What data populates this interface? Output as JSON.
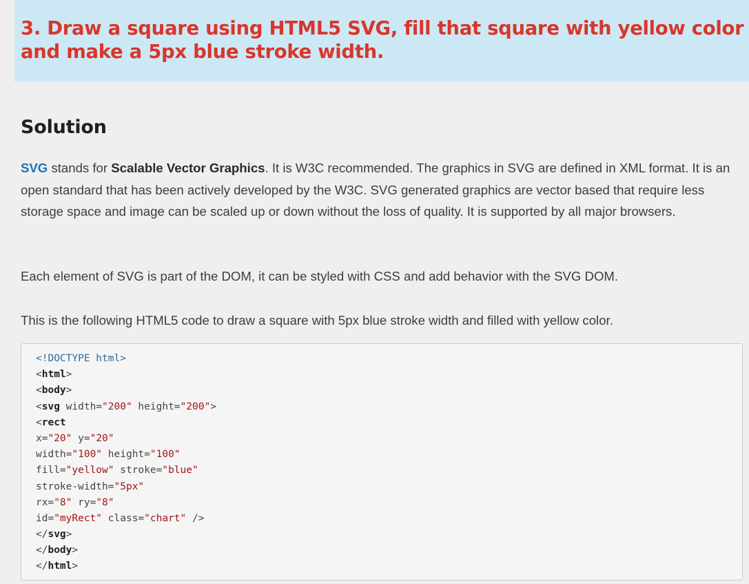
{
  "question": {
    "title": "3. Draw a square using HTML5 SVG, fill that square with yellow color and make a 5px blue stroke width."
  },
  "solution": {
    "heading": "Solution",
    "paragraph1": {
      "link": "SVG",
      "text_a": " stands for ",
      "bold": "Scalable Vector Graphics",
      "text_b": ". It is W3C recommended. The graphics in SVG are defined in XML format. It is an open standard that has been actively developed by the W3C. SVG generated graphics are vector based that require less storage space and image can be scaled up or down without the loss of quality. It is supported by all major browsers."
    },
    "paragraph2": "Each element of SVG is part of the DOM, it can be styled with CSS and add behavior with the SVG DOM.",
    "paragraph3": "This is the following HTML5 code to draw a square with 5px blue stroke width and filled with yellow color."
  },
  "code": {
    "lines": [
      [
        {
          "t": "doctype",
          "v": "<!DOCTYPE html>"
        }
      ],
      [
        {
          "t": "punct",
          "v": "<"
        },
        {
          "t": "tag",
          "v": "html"
        },
        {
          "t": "punct",
          "v": ">"
        }
      ],
      [
        {
          "t": "punct",
          "v": "<"
        },
        {
          "t": "tag",
          "v": "body"
        },
        {
          "t": "punct",
          "v": ">"
        }
      ],
      [
        {
          "t": "punct",
          "v": "<"
        },
        {
          "t": "tag",
          "v": "svg"
        },
        {
          "t": "attr",
          "v": " width="
        },
        {
          "t": "val",
          "v": "\"200\""
        },
        {
          "t": "attr",
          "v": " height="
        },
        {
          "t": "val",
          "v": "\"200\""
        },
        {
          "t": "punct",
          "v": ">"
        }
      ],
      [
        {
          "t": "punct",
          "v": "<"
        },
        {
          "t": "tag",
          "v": "rect"
        }
      ],
      [
        {
          "t": "attr",
          "v": "x="
        },
        {
          "t": "val",
          "v": "\"20\""
        },
        {
          "t": "attr",
          "v": " y="
        },
        {
          "t": "val",
          "v": "\"20\""
        }
      ],
      [
        {
          "t": "attr",
          "v": "width="
        },
        {
          "t": "val",
          "v": "\"100\""
        },
        {
          "t": "attr",
          "v": " height="
        },
        {
          "t": "val",
          "v": "\"100\""
        }
      ],
      [
        {
          "t": "attr",
          "v": "fill="
        },
        {
          "t": "val",
          "v": "\"yellow\""
        },
        {
          "t": "attr",
          "v": " stroke="
        },
        {
          "t": "val",
          "v": "\"blue\""
        }
      ],
      [
        {
          "t": "attr",
          "v": "stroke-width="
        },
        {
          "t": "val",
          "v": "\"5px\""
        }
      ],
      [
        {
          "t": "attr",
          "v": "rx="
        },
        {
          "t": "val",
          "v": "\"8\""
        },
        {
          "t": "attr",
          "v": " ry="
        },
        {
          "t": "val",
          "v": "\"8\""
        }
      ],
      [
        {
          "t": "attr",
          "v": "id="
        },
        {
          "t": "val",
          "v": "\"myRect\""
        },
        {
          "t": "attr",
          "v": " class="
        },
        {
          "t": "val",
          "v": "\"chart\""
        },
        {
          "t": "punct",
          "v": " />"
        }
      ],
      [
        {
          "t": "punct",
          "v": "</"
        },
        {
          "t": "tag",
          "v": "svg"
        },
        {
          "t": "punct",
          "v": ">"
        }
      ],
      [
        {
          "t": "punct",
          "v": "</"
        },
        {
          "t": "tag",
          "v": "body"
        },
        {
          "t": "punct",
          "v": ">"
        }
      ],
      [
        {
          "t": "punct",
          "v": "</"
        },
        {
          "t": "tag",
          "v": "html"
        },
        {
          "t": "punct",
          "v": ">"
        }
      ]
    ]
  },
  "colors": {
    "question_bg": "#cde8f5",
    "question_text": "#d9362b",
    "link": "#1b72b8",
    "page_bg": "#efefef",
    "code_bg": "#f5f5f5",
    "code_string": "#a31515"
  }
}
